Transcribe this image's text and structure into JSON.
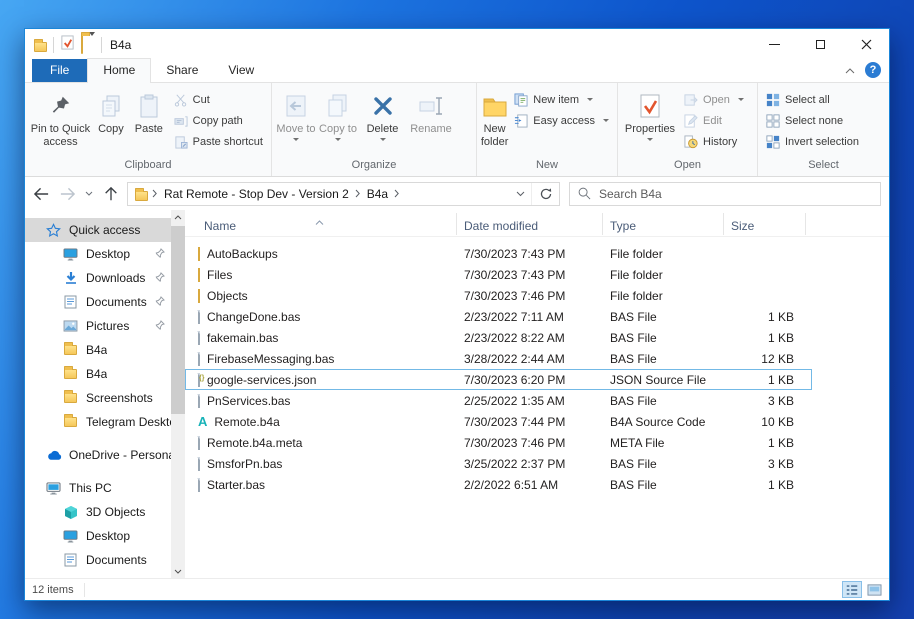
{
  "window": {
    "title": "B4a"
  },
  "tabs": {
    "file": "File",
    "home": "Home",
    "share": "Share",
    "view": "View"
  },
  "ribbon": {
    "clipboard": {
      "label": "Clipboard",
      "pin": "Pin to Quick access",
      "copy": "Copy",
      "paste": "Paste",
      "cut": "Cut",
      "copy_path": "Copy path",
      "paste_shortcut": "Paste shortcut"
    },
    "organize": {
      "label": "Organize",
      "move_to": "Move to",
      "copy_to": "Copy to",
      "delete": "Delete",
      "rename": "Rename"
    },
    "new": {
      "label": "New",
      "new_folder": "New folder",
      "new_item": "New item",
      "easy_access": "Easy access"
    },
    "open": {
      "label": "Open",
      "properties": "Properties",
      "open": "Open",
      "edit": "Edit",
      "history": "History"
    },
    "select": {
      "label": "Select",
      "select_all": "Select all",
      "select_none": "Select none",
      "invert": "Invert selection"
    }
  },
  "navbar": {
    "breadcrumb": [
      "Rat Remote - Stop Dev - Version 2",
      "B4a"
    ],
    "search_placeholder": "Search B4a"
  },
  "sidebar": {
    "items": [
      {
        "label": "Quick access",
        "icon": "quick-access-star-icon",
        "level": 0,
        "selected": true,
        "pinned": false,
        "gap_before": false
      },
      {
        "label": "Desktop",
        "icon": "desktop-icon",
        "level": 1,
        "selected": false,
        "pinned": true,
        "gap_before": false
      },
      {
        "label": "Downloads",
        "icon": "downloads-icon",
        "level": 1,
        "selected": false,
        "pinned": true,
        "gap_before": false
      },
      {
        "label": "Documents",
        "icon": "documents-icon",
        "level": 1,
        "selected": false,
        "pinned": true,
        "gap_before": false
      },
      {
        "label": "Pictures",
        "icon": "pictures-icon",
        "level": 1,
        "selected": false,
        "pinned": true,
        "gap_before": false
      },
      {
        "label": "B4a",
        "icon": "folder-icon",
        "level": 1,
        "selected": false,
        "pinned": false,
        "gap_before": false
      },
      {
        "label": "B4a",
        "icon": "folder-icon",
        "level": 1,
        "selected": false,
        "pinned": false,
        "gap_before": false
      },
      {
        "label": "Screenshots",
        "icon": "folder-icon",
        "level": 1,
        "selected": false,
        "pinned": false,
        "gap_before": false
      },
      {
        "label": "Telegram Desktop",
        "icon": "folder-icon",
        "level": 1,
        "selected": false,
        "pinned": false,
        "gap_before": false
      },
      {
        "label": "OneDrive - Persona",
        "icon": "onedrive-icon",
        "level": 0,
        "selected": false,
        "pinned": false,
        "gap_before": true
      },
      {
        "label": "This PC",
        "icon": "this-pc-icon",
        "level": 0,
        "selected": false,
        "pinned": false,
        "gap_before": true
      },
      {
        "label": "3D Objects",
        "icon": "objects-3d-icon",
        "level": 1,
        "selected": false,
        "pinned": false,
        "gap_before": false
      },
      {
        "label": "Desktop",
        "icon": "desktop-icon",
        "level": 1,
        "selected": false,
        "pinned": false,
        "gap_before": false
      },
      {
        "label": "Documents",
        "icon": "documents-icon",
        "level": 1,
        "selected": false,
        "pinned": false,
        "gap_before": false
      }
    ]
  },
  "files": {
    "columns": {
      "name": "Name",
      "date": "Date modified",
      "type": "Type",
      "size": "Size"
    },
    "rows": [
      {
        "name": "AutoBackups",
        "date": "7/30/2023 7:43 PM",
        "type": "File folder",
        "size": "",
        "icon": "folder-icon",
        "selected": false
      },
      {
        "name": "Files",
        "date": "7/30/2023 7:43 PM",
        "type": "File folder",
        "size": "",
        "icon": "folder-icon",
        "selected": false
      },
      {
        "name": "Objects",
        "date": "7/30/2023 7:46 PM",
        "type": "File folder",
        "size": "",
        "icon": "folder-icon",
        "selected": false
      },
      {
        "name": "ChangeDone.bas",
        "date": "2/23/2022 7:11 AM",
        "type": "BAS File",
        "size": "1 KB",
        "icon": "file-icon",
        "selected": false
      },
      {
        "name": "fakemain.bas",
        "date": "2/23/2022 8:22 AM",
        "type": "BAS File",
        "size": "1 KB",
        "icon": "file-icon",
        "selected": false
      },
      {
        "name": "FirebaseMessaging.bas",
        "date": "3/28/2022 2:44 AM",
        "type": "BAS File",
        "size": "12 KB",
        "icon": "file-icon",
        "selected": false
      },
      {
        "name": "google-services.json",
        "date": "7/30/2023 6:20 PM",
        "type": "JSON Source File",
        "size": "1 KB",
        "icon": "json-file-icon",
        "selected": true
      },
      {
        "name": "PnServices.bas",
        "date": "2/25/2022 1:35 AM",
        "type": "BAS File",
        "size": "3 KB",
        "icon": "file-icon",
        "selected": false
      },
      {
        "name": "Remote.b4a",
        "date": "7/30/2023 7:44 PM",
        "type": "B4A Source Code",
        "size": "10 KB",
        "icon": "b4a-file-icon",
        "selected": false
      },
      {
        "name": "Remote.b4a.meta",
        "date": "7/30/2023 7:46 PM",
        "type": "META File",
        "size": "1 KB",
        "icon": "file-icon",
        "selected": false
      },
      {
        "name": "SmsforPn.bas",
        "date": "3/25/2022 2:37 PM",
        "type": "BAS File",
        "size": "3 KB",
        "icon": "file-icon",
        "selected": false
      },
      {
        "name": "Starter.bas",
        "date": "2/2/2022 6:51 AM",
        "type": "BAS File",
        "size": "1 KB",
        "icon": "file-icon",
        "selected": false
      }
    ]
  },
  "status": {
    "items_count": "12 items"
  },
  "colors": {
    "accent": "#1e6bb8",
    "selection_border": "#73b9e6",
    "window_border": "#1a86d9",
    "folder": "#ffd566"
  }
}
